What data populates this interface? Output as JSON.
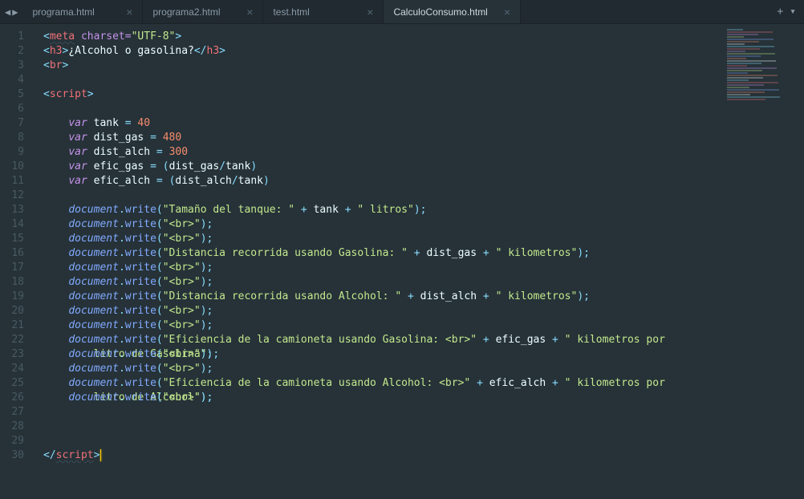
{
  "tabs": {
    "t0": "programa.html",
    "t1": "programa2.html",
    "t2": "test.html",
    "t3": "CalculoConsumo.html"
  },
  "lineNumbers": [
    "1",
    "2",
    "3",
    "4",
    "5",
    "6",
    "7",
    "8",
    "9",
    "10",
    "11",
    "12",
    "13",
    "14",
    "15",
    "16",
    "17",
    "18",
    "19",
    "20",
    "21",
    "22",
    "23",
    "24",
    "25",
    "26",
    "27",
    "28",
    "29",
    "30"
  ],
  "code": {
    "l1": {
      "tag": "meta",
      "attr": "charset=",
      "str": "\"UTF-8\""
    },
    "l2": {
      "tag": "h3",
      "text": "¿Alcohol o gasolina?"
    },
    "l3": {
      "tag": "br"
    },
    "l5": {
      "tag": "script"
    },
    "l7": {
      "kw": "var",
      "name": "tank",
      "op": " = ",
      "val": "40"
    },
    "l8": {
      "kw": "var",
      "name": "dist_gas",
      "op": " = ",
      "val": "480"
    },
    "l9": {
      "kw": "var",
      "name": "dist_alch",
      "op": " = ",
      "val": "300"
    },
    "l10": {
      "kw": "var",
      "name": "efic_gas",
      "op": " = ",
      "expr_a": "dist_gas",
      "expr_op": "/",
      "expr_b": "tank"
    },
    "l11": {
      "kw": "var",
      "name": "efic_alch",
      "op": " = ",
      "expr_a": "dist_alch",
      "expr_op": "/",
      "expr_b": "tank"
    },
    "dw_l13_a": "\"Tamaño del tanque: \"",
    "dw_l13_v": "tank",
    "dw_l13_b": "\" litros\"",
    "brcall": "\"<br>\"",
    "dw_l16_a": "\"Distancia recorrida usando Gasolina: \"",
    "dw_l16_v": "dist_gas",
    "dw_l16_b": "\" kilometros\"",
    "dw_l19_a": "\"Distancia recorrida usando Alcohol: \"",
    "dw_l19_v": "dist_alch",
    "dw_l19_b": "\" kilometros\"",
    "dw_l22_a": "\"Eficiencia de la camioneta usando Gasolina: <br>\"",
    "dw_l22_v": "efic_gas",
    "dw_l22_b": "\" kilometros por ",
    "dw_l22_c": "litro de Gasolina\"",
    "dw_l25_a": "\"Eficiencia de la camioneta usando Alcohol: <br>\"",
    "dw_l25_v": "efic_alch",
    "dw_l25_b": "\" kilometros por ",
    "dw_l25_c": "litro de Alcohol\"",
    "doc": "document",
    "write": "write",
    "plus": " + "
  }
}
